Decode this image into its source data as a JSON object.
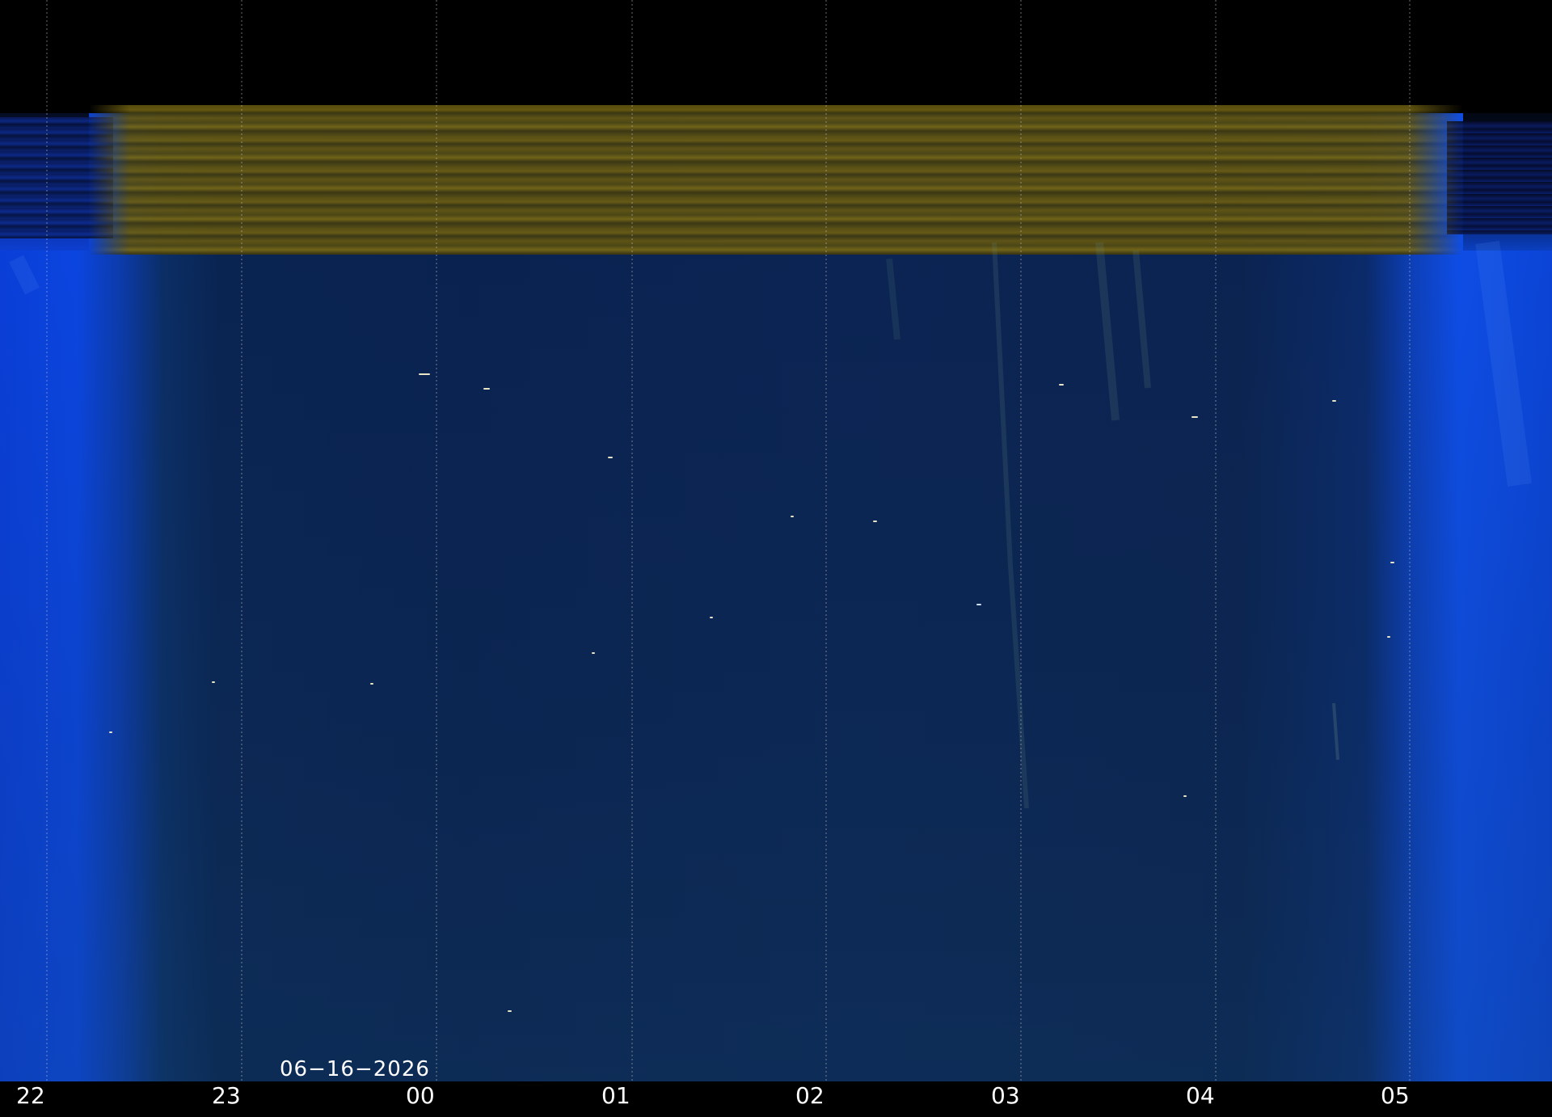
{
  "date_label": "06−16−2026",
  "hour_labels": [
    "22",
    "23",
    "00",
    "01",
    "02",
    "03",
    "04",
    "05"
  ],
  "colors": {
    "sky_deep": "#0b2350",
    "twilight_blue": "#0b44d6",
    "ochre_band": "#6e5f12",
    "text": "#ffffff"
  }
}
